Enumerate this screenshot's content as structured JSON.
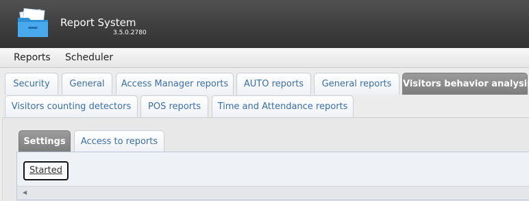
{
  "app": {
    "title": "Report System",
    "version": "3.5.0.2780"
  },
  "menu": {
    "items": [
      "Reports",
      "Scheduler"
    ]
  },
  "tabs": {
    "row1": [
      "Security",
      "General",
      "Access Manager reports",
      "AUTO reports",
      "General reports",
      "Visitors behavior analysis"
    ],
    "row2": [
      "Visitors counting detectors",
      "POS reports",
      "Time and Attendance reports"
    ],
    "active": "Visitors behavior analysis"
  },
  "subtabs": {
    "items": [
      "Settings",
      "Access to reports"
    ],
    "active": "Settings"
  },
  "content": {
    "started_label": "Started"
  },
  "colors": {
    "tab_text": "#3a6ea5",
    "active_tab_bg": "#8a8a8a",
    "header_bg": "#444444"
  },
  "icons": {
    "logo": "folder-icon",
    "scroll_left": "scroll-left-arrow-icon"
  }
}
